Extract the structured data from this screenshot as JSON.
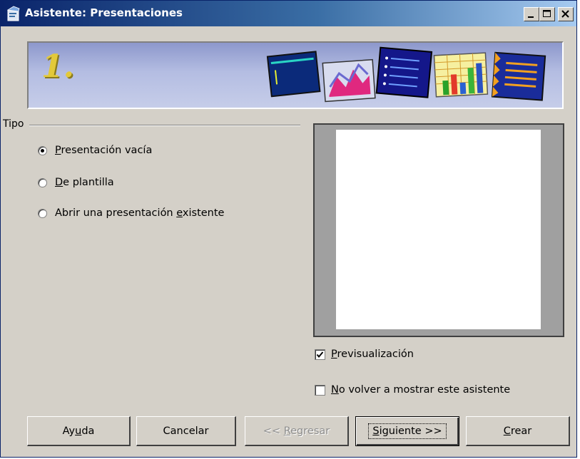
{
  "window": {
    "title": "Asistente: Presentaciones"
  },
  "banner": {
    "step": "1."
  },
  "tipo": {
    "label": "Tipo",
    "options": [
      {
        "pre": "",
        "key": "P",
        "post": "resentación vacía",
        "checked": true
      },
      {
        "pre": "",
        "key": "D",
        "post": "e plantilla",
        "checked": false
      },
      {
        "pre": "Abrir una presentación ",
        "key": "e",
        "post": "xistente",
        "checked": false
      }
    ]
  },
  "checks": {
    "preview": {
      "key": "P",
      "post": "revisualización",
      "checked": true
    },
    "no_show": {
      "key": "N",
      "post": "o volver a mostrar este asistente",
      "checked": false
    }
  },
  "buttons": {
    "help": {
      "pre": "Ay",
      "key": "u",
      "post": "da"
    },
    "cancel": {
      "label": "Cancelar"
    },
    "back": {
      "pre": "<< ",
      "key": "R",
      "post": "egresar"
    },
    "next": {
      "pre": "",
      "key": "S",
      "post": "iguiente >>"
    },
    "create": {
      "pre": "",
      "key": "C",
      "post": "rear"
    }
  },
  "colors": {
    "titlebar_start": "#0a246a",
    "titlebar_end": "#a6caf0",
    "dialog_bg": "#d4d0c8"
  }
}
